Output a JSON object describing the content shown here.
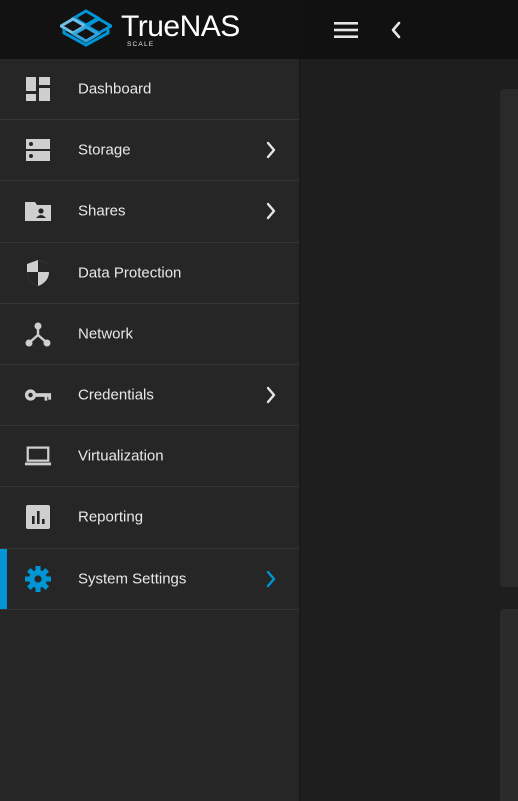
{
  "brand": {
    "name": "TrueNAS",
    "edition": "SCALE"
  },
  "topbar": {
    "menu_icon": "hamburger-menu-icon",
    "collapse_icon": "chevron-left-icon"
  },
  "sidebar": {
    "items": [
      {
        "label": "Dashboard",
        "icon": "dashboard-icon",
        "has_submenu": false,
        "active": false
      },
      {
        "label": "Storage",
        "icon": "storage-icon",
        "has_submenu": true,
        "active": false
      },
      {
        "label": "Shares",
        "icon": "shared-folder-icon",
        "has_submenu": true,
        "active": false
      },
      {
        "label": "Data Protection",
        "icon": "shield-icon",
        "has_submenu": false,
        "active": false
      },
      {
        "label": "Network",
        "icon": "network-icon",
        "has_submenu": false,
        "active": false
      },
      {
        "label": "Credentials",
        "icon": "key-icon",
        "has_submenu": true,
        "active": false
      },
      {
        "label": "Virtualization",
        "icon": "laptop-icon",
        "has_submenu": false,
        "active": false
      },
      {
        "label": "Reporting",
        "icon": "bar-chart-icon",
        "has_submenu": false,
        "active": false
      },
      {
        "label": "System Settings",
        "icon": "gear-icon",
        "has_submenu": true,
        "active": true
      }
    ]
  },
  "colors": {
    "accent": "#0095d5",
    "sidebar_bg": "#262626",
    "topbar_bg": "#111111",
    "text": "#e8e8e8"
  }
}
